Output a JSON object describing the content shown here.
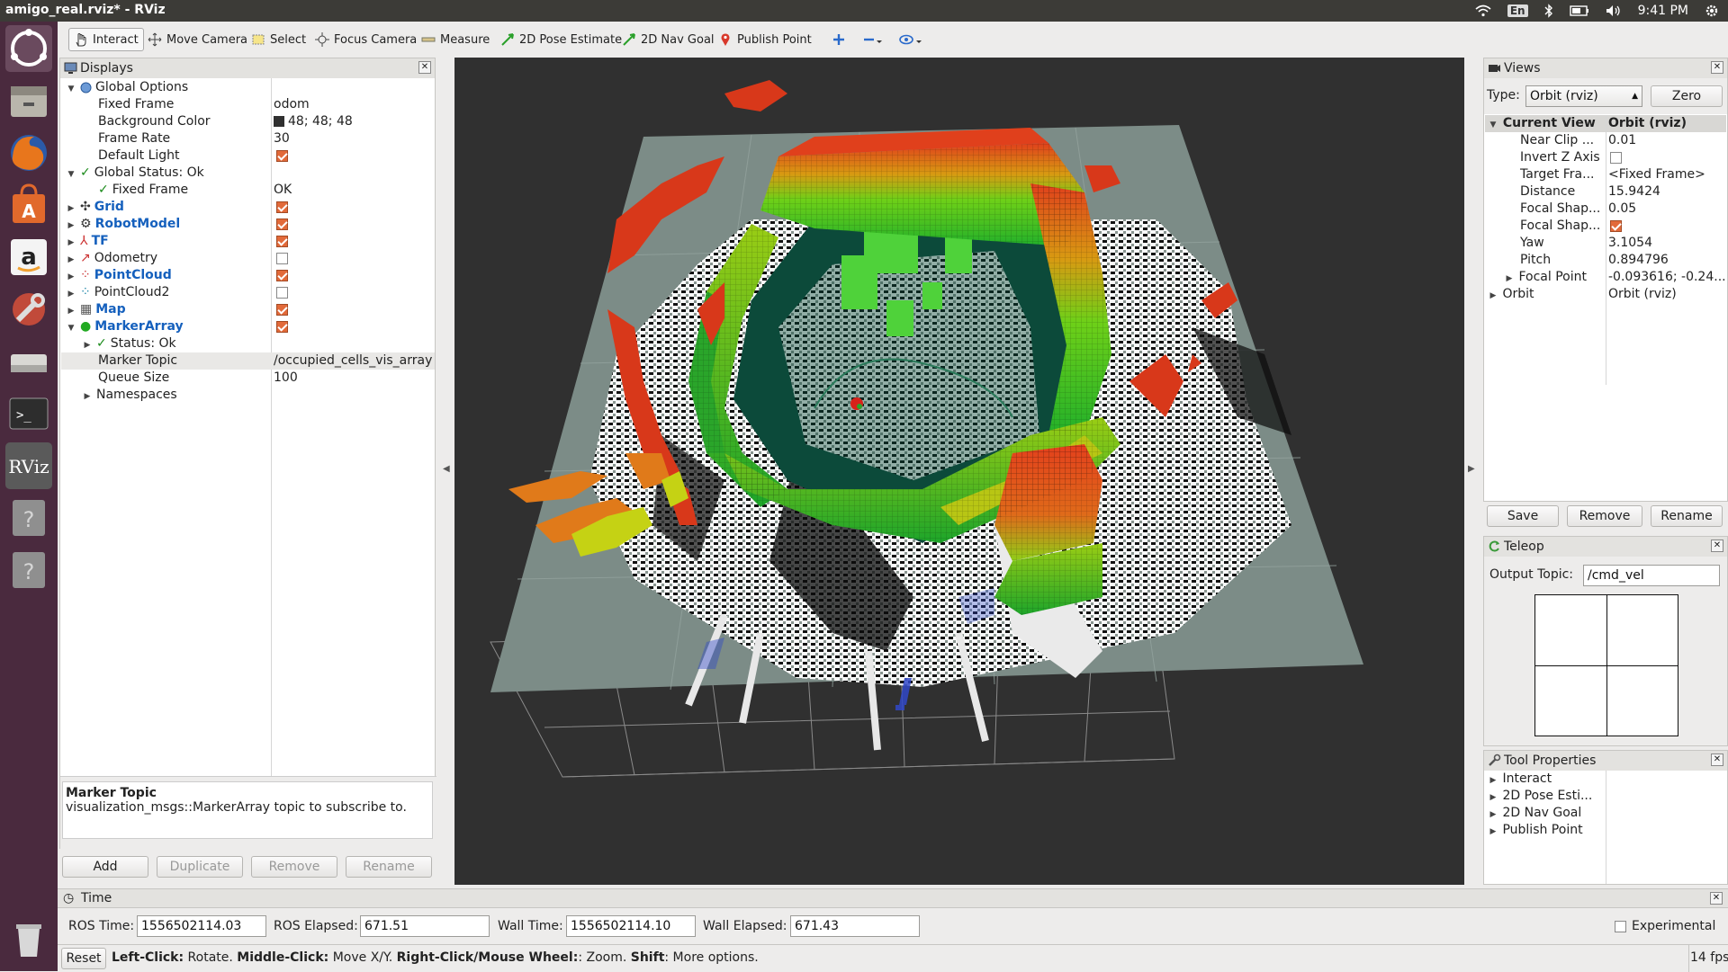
{
  "window": {
    "title": "amigo_real.rviz* - RViz"
  },
  "topbar": {
    "lang": "En",
    "clock": "9:41 PM"
  },
  "launcher": [
    "ubuntu-icon",
    "files-icon",
    "firefox-icon",
    "software-center-icon",
    "amazon-icon",
    "settings-icon",
    "disk-icon",
    "terminal-icon",
    "rviz-icon",
    "unknown-app-icon",
    "unknown-app-icon"
  ],
  "launcher_labels": {
    "rviz": "RViz"
  },
  "toolbar": {
    "interact": "Interact",
    "move_camera": "Move Camera",
    "select": "Select",
    "focus_camera": "Focus Camera",
    "measure": "Measure",
    "pose_estimate": "2D Pose Estimate",
    "nav_goal": "2D Nav Goal",
    "publish_point": "Publish Point"
  },
  "displays": {
    "title": "Displays",
    "rows": [
      {
        "label": "Global Options",
        "value": ""
      },
      {
        "label": "Fixed Frame",
        "value": "odom"
      },
      {
        "label": "Background Color",
        "value": "48; 48; 48"
      },
      {
        "label": "Frame Rate",
        "value": "30"
      },
      {
        "label": "Default Light",
        "value": ""
      },
      {
        "label": "Global Status: Ok",
        "value": ""
      },
      {
        "label": "Fixed Frame",
        "value": "OK"
      },
      {
        "label": "Grid",
        "value": ""
      },
      {
        "label": "RobotModel",
        "value": ""
      },
      {
        "label": "TF",
        "value": ""
      },
      {
        "label": "Odometry",
        "value": ""
      },
      {
        "label": "PointCloud",
        "value": ""
      },
      {
        "label": "PointCloud2",
        "value": ""
      },
      {
        "label": "Map",
        "value": ""
      },
      {
        "label": "MarkerArray",
        "value": ""
      },
      {
        "label": "Status: Ok",
        "value": ""
      },
      {
        "label": "Marker Topic",
        "value": "/occupied_cells_vis_array"
      },
      {
        "label": "Queue Size",
        "value": "100"
      },
      {
        "label": "Namespaces",
        "value": ""
      }
    ],
    "desc_title": "Marker Topic",
    "desc_text": "visualization_msgs::MarkerArray topic to subscribe to.",
    "buttons": {
      "add": "Add",
      "duplicate": "Duplicate",
      "remove": "Remove",
      "rename": "Rename"
    }
  },
  "views": {
    "title": "Views",
    "type_label": "Type:",
    "type_value": "Orbit (rviz)",
    "zero": "Zero",
    "rows": [
      {
        "label": "Current View",
        "value": "Orbit (rviz)"
      },
      {
        "label": "Near Clip ...",
        "value": "0.01"
      },
      {
        "label": "Invert Z Axis",
        "value": ""
      },
      {
        "label": "Target Fra...",
        "value": "<Fixed Frame>"
      },
      {
        "label": "Distance",
        "value": "15.9424"
      },
      {
        "label": "Focal Shap...",
        "value": "0.05"
      },
      {
        "label": "Focal Shap...",
        "value": ""
      },
      {
        "label": "Yaw",
        "value": "3.1054"
      },
      {
        "label": "Pitch",
        "value": "0.894796"
      },
      {
        "label": "Focal Point",
        "value": "-0.093616; -0.24..."
      },
      {
        "label": "Orbit",
        "value": "Orbit (rviz)"
      }
    ],
    "buttons": {
      "save": "Save",
      "remove": "Remove",
      "rename": "Rename"
    }
  },
  "teleop": {
    "title": "Teleop",
    "output_label": "Output Topic:",
    "output_value": "/cmd_vel"
  },
  "tool_props": {
    "title": "Tool Properties",
    "items": [
      "Interact",
      "2D Pose Esti...",
      "2D Nav Goal",
      "Publish Point"
    ]
  },
  "time": {
    "title": "Time",
    "ros_time_label": "ROS Time:",
    "ros_time": "1556502114.03",
    "ros_elapsed_label": "ROS Elapsed:",
    "ros_elapsed": "671.51",
    "wall_time_label": "Wall Time:",
    "wall_time": "1556502114.10",
    "wall_elapsed_label": "Wall Elapsed:",
    "wall_elapsed": "671.43",
    "experimental": "Experimental"
  },
  "status": {
    "reset": "Reset",
    "k1": "Left-Click:",
    "t1": " Rotate. ",
    "k2": "Middle-Click:",
    "t2": " Move X/Y. ",
    "k3": "Right-Click/Mouse Wheel:",
    "t3": ": Zoom. ",
    "k4": "Shift",
    "t4": ": More options.",
    "fps": "14 fps"
  },
  "colors": {
    "viewport_bg": "#303030",
    "launcher": "#4a2a3e",
    "accent": "#e26a3a"
  }
}
